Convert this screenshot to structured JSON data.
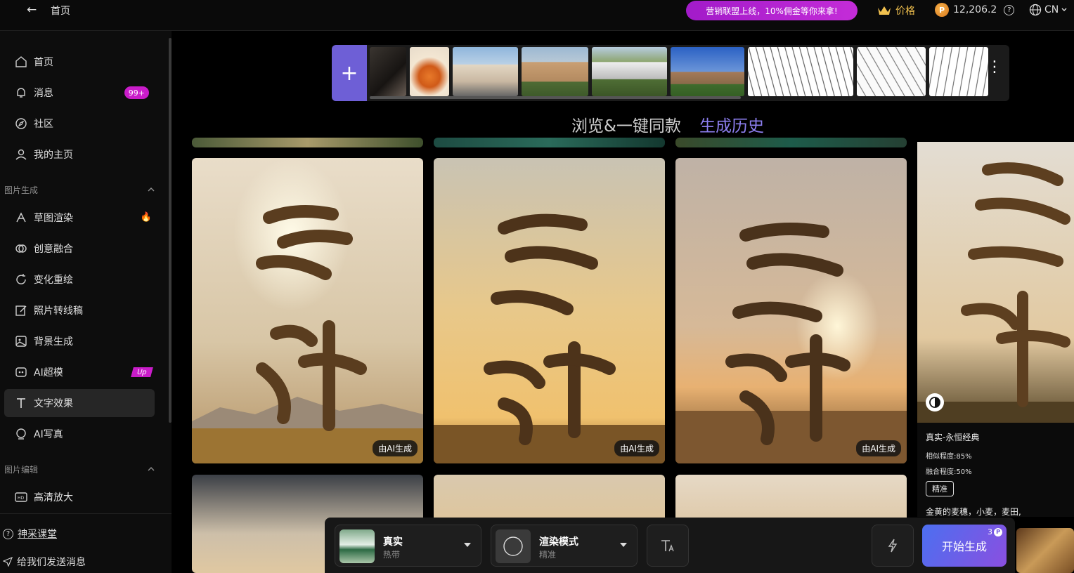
{
  "topbar": {
    "back_arrow": "←",
    "title": "首页",
    "promo": "营销联盟上线，10%佣金等你来拿!",
    "price_label": "价格",
    "credits": "12,206.2",
    "language": "CN"
  },
  "sidebar": {
    "items": [
      {
        "label": "首页",
        "icon": "home-icon"
      },
      {
        "label": "消息",
        "icon": "bell-icon",
        "badge": "99+"
      },
      {
        "label": "社区",
        "icon": "compass-icon"
      },
      {
        "label": "我的主页",
        "icon": "user-icon"
      }
    ],
    "section_image_gen": "图片生成",
    "gen_items": [
      {
        "label": "草图渲染",
        "icon": "sketch-icon",
        "hot": true
      },
      {
        "label": "创意融合",
        "icon": "blend-icon"
      },
      {
        "label": "变化重绘",
        "icon": "refresh-icon"
      },
      {
        "label": "照片转线稿",
        "icon": "edit-icon"
      },
      {
        "label": "背景生成",
        "icon": "image-icon"
      },
      {
        "label": "AI超模",
        "icon": "ai-model-icon",
        "badge": "Up"
      },
      {
        "label": "文字效果",
        "icon": "text-icon",
        "active": true
      },
      {
        "label": "AI写真",
        "icon": "portrait-icon"
      }
    ],
    "section_image_edit": "图片编辑",
    "edit_items": [
      {
        "label": "高清放大",
        "icon": "hd-icon"
      }
    ],
    "bottom": {
      "course": "神采课堂",
      "feedback": "给我们发送消息"
    }
  },
  "tabs": {
    "browse": "浏览&一键同款",
    "history": "生成历史"
  },
  "cards": {
    "ai_label": "由AI生成"
  },
  "detail": {
    "title": "真实-永恒经典",
    "similarity": "相似程度:85%",
    "fusion": "融合程度:50%",
    "tag": "精准",
    "prompt": "金黄的麦穗，小麦，麦田,"
  },
  "bottombar": {
    "style_title": "真实",
    "style_sub": "热带",
    "mode_title": "渲染模式",
    "mode_sub": "精准",
    "generate": "开始生成",
    "cost": "3"
  },
  "colors": {
    "accent": "#8d7ff0",
    "promo": "#c42cd8",
    "badge": "#c91cc9"
  }
}
